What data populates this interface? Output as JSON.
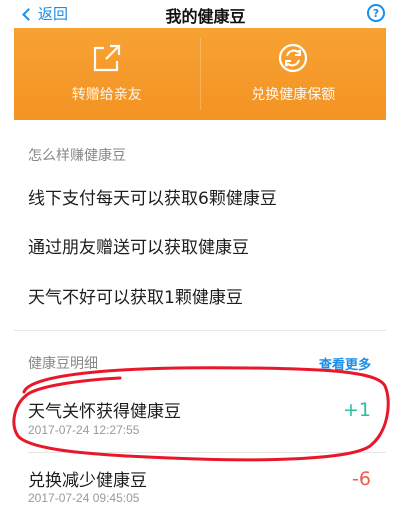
{
  "nav": {
    "back_label": "返回",
    "title": "我的健康豆",
    "help_glyph": "?"
  },
  "banner": {
    "transfer_label": "转赠给亲友",
    "exchange_label": "兑换健康保额",
    "color": "#f39a2a"
  },
  "earn": {
    "title": "怎么样赚健康豆",
    "items": [
      "线下支付每天可以获取6颗健康豆",
      "通过朋友赠送可以获取健康豆",
      "天气不好可以获取1颗健康豆"
    ]
  },
  "detail": {
    "title": "健康豆明细",
    "see_more": "查看更多",
    "rows": [
      {
        "title": "天气关怀获得健康豆",
        "date": "2017-07-24 12:27:55",
        "amount": "+1"
      },
      {
        "title": "兑换减少健康豆",
        "date": "2017-07-24 09:45:05",
        "amount": "-6"
      }
    ]
  },
  "colors": {
    "accent": "#1a8ee8",
    "positive": "#2cc0a3",
    "negative": "#f05a4a",
    "annotation": "#e8182a"
  }
}
